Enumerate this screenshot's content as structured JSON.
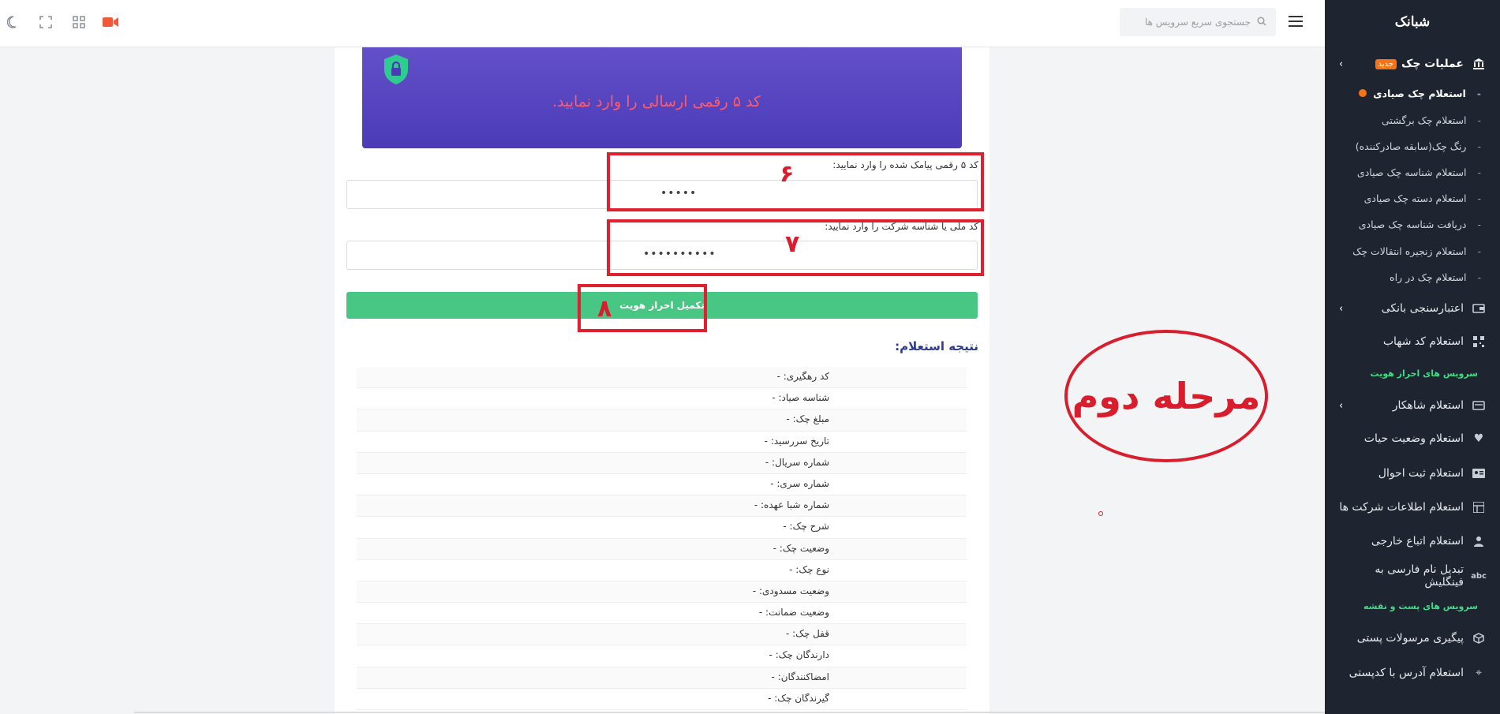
{
  "brand": {
    "name": "شبانک"
  },
  "search": {
    "placeholder": "جستجوی سریع سرویس ها"
  },
  "sidebar": {
    "check_ops": {
      "label": "عملیات چک",
      "badge": "جدید"
    },
    "sub_items": [
      "استعلام چک صیادی",
      "استعلام چک برگشتی",
      "رنگ چک(سابقه صادرکننده)",
      "استعلام شناسه چک صیادی",
      "استعلام دسته چک صیادی",
      "دریافت شناسه چک صیادی",
      "استعلام زنجیره انتقالات چک",
      "استعلام چک در راه"
    ],
    "credit": "اعتبارسنجی بانکی",
    "shahab": "استعلام کد شهاب",
    "identity_section": "سرویس های احراز هویت",
    "shahkar": "استعلام شاهکار",
    "alive": "استعلام وضعیت حیات",
    "civil": "استعلام ثبت احوال",
    "companies": "استعلام اطلاعات شرکت ها",
    "foreign": "استعلام اتباع خارجی",
    "translit": "تبدیل نام فارسی به فینگلیش",
    "post_section": "سرویس های پست و نقشه",
    "postal": "پیگیری مرسولات پستی",
    "address": "استعلام آدرس با کدپستی"
  },
  "banner": {
    "text": "کد ۵ رقمی ارسالی را وارد نمایید."
  },
  "form": {
    "sms_label": "کد ۵ رقمی پیامک شده را وارد نمایید:",
    "sms_value": "•••••",
    "national_label": "کد ملی یا شناسه شرکت را وارد نمایید:",
    "national_value": "••••••••••",
    "submit": "تکمیل احراز هویت"
  },
  "result": {
    "title": "نتیجه استعلام:",
    "rows": [
      "کد رهگیری:  -",
      "شناسه صیاد:  -",
      "مبلغ چک:  -",
      "تاریخ سررسید:  -",
      "شماره سریال:  -",
      "شماره سری:  -",
      "شماره شبا عهده:  -",
      "شرح چک:  -",
      "وضعیت چک:  -",
      "نوع چک:  -",
      "وضعیت مسدودی:  -",
      "وضعیت ضمانت:  -",
      "قفل چک:  -",
      "دارندگان چک:  -",
      "امضاکنندگان:  -",
      "گیرندگان چک:  -"
    ]
  },
  "annotations": {
    "n6": "۶",
    "n7": "۷",
    "n8": "۸",
    "stage": "مرحله دوم",
    "color": "#d81e2c"
  }
}
